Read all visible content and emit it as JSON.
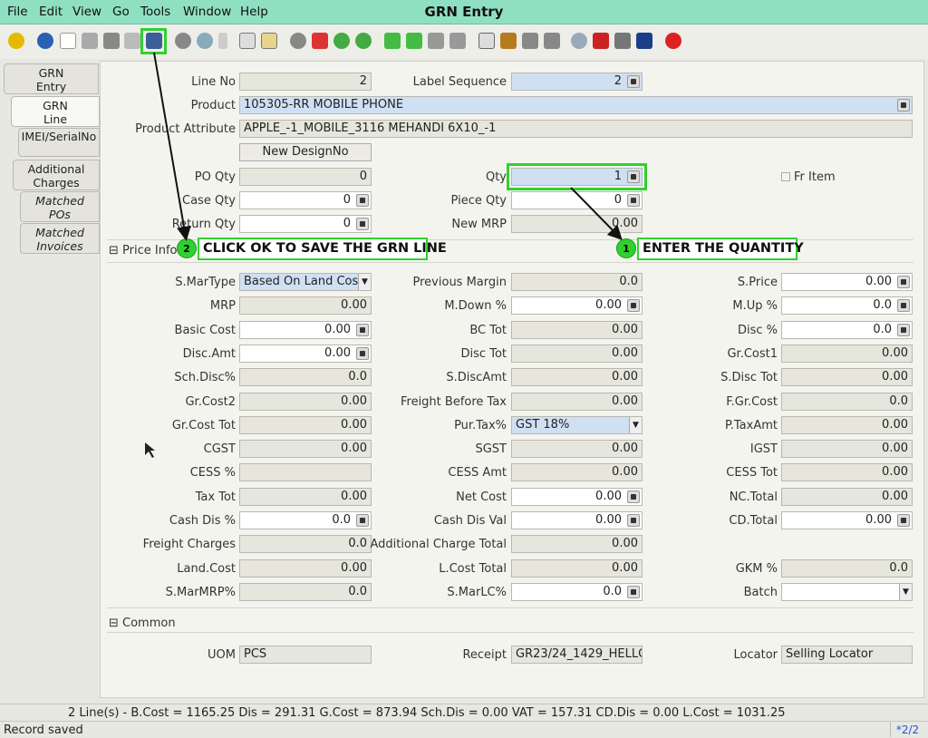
{
  "app_title": "GRN Entry",
  "menu": [
    "File",
    "Edit",
    "View",
    "Go",
    "Tools",
    "Window",
    "Help"
  ],
  "toolbar_icons": [
    "undo-icon",
    "help-icon",
    "new-icon",
    "copy-icon",
    "delete-icon",
    "delete-selection-icon",
    "save-icon",
    "refresh-icon",
    "find-icon",
    "attachment-icon",
    "chat-icon",
    "history-icon",
    "home-icon",
    "parent-icon",
    "previous-icon",
    "next-icon",
    "first-icon",
    "prev-record-icon",
    "next-record-icon",
    "last-icon",
    "report-icon",
    "archive-icon",
    "print-icon",
    "print-preview-icon",
    "zoom-across-icon",
    "workflow-icon",
    "process-icon",
    "product-info-icon",
    "exit-icon"
  ],
  "left_tabs": [
    {
      "label": "GRN\nEntry",
      "active": false,
      "italic": false
    },
    {
      "label": "GRN\nLine",
      "active": true,
      "italic": false
    },
    {
      "label": "IMEI/SerialNo",
      "active": false,
      "italic": false
    },
    {
      "label": "Additional\nCharges",
      "active": false,
      "italic": false
    },
    {
      "label": "Matched\nPOs",
      "active": false,
      "italic": true
    },
    {
      "label": "Matched\nInvoices",
      "active": false,
      "italic": true
    }
  ],
  "fields": {
    "line_no": {
      "label": "Line No",
      "value": "2"
    },
    "label_sequence": {
      "label": "Label Sequence",
      "value": "2"
    },
    "product": {
      "label": "Product",
      "value": "105305-RR MOBILE PHONE"
    },
    "product_attribute": {
      "label": "Product Attribute",
      "value": "APPLE_-1_MOBILE_3116 MEHANDI 6X10_-1"
    },
    "new_design_no": {
      "label": "New DesignNo"
    },
    "po_qty": {
      "label": "PO Qty",
      "value": "0"
    },
    "qty": {
      "label": "Qty",
      "value": "1"
    },
    "fr_item": {
      "label": "Fr Item"
    },
    "case_qty": {
      "label": "Case Qty",
      "value": "0"
    },
    "piece_qty": {
      "label": "Piece Qty",
      "value": "0"
    },
    "return_qty": {
      "label": "Return Qty",
      "value": "0"
    },
    "new_mrp": {
      "label": "New MRP",
      "value": "0.00"
    }
  },
  "price_info": {
    "section_label": "Price Info",
    "s_martype": {
      "label": "S.MarType",
      "value": "Based On Land Cost"
    },
    "previous_margin": {
      "label": "Previous Margin",
      "value": "0.0"
    },
    "s_price": {
      "label": "S.Price",
      "value": "0.00"
    },
    "mrp": {
      "label": "MRP",
      "value": "0.00"
    },
    "m_down": {
      "label": "M.Down %",
      "value": "0.00"
    },
    "m_up": {
      "label": "M.Up %",
      "value": "0.0"
    },
    "basic_cost": {
      "label": "Basic Cost",
      "value": "0.00"
    },
    "bc_tot": {
      "label": "BC Tot",
      "value": "0.00"
    },
    "disc_pct": {
      "label": "Disc %",
      "value": "0.0"
    },
    "disc_amt": {
      "label": "Disc.Amt",
      "value": "0.00"
    },
    "disc_tot": {
      "label": "Disc Tot",
      "value": "0.00"
    },
    "gr_cost1": {
      "label": "Gr.Cost1",
      "value": "0.00"
    },
    "sch_disc_pct": {
      "label": "Sch.Disc%",
      "value": "0.0"
    },
    "s_discamt": {
      "label": "S.DiscAmt",
      "value": "0.00"
    },
    "s_disc_tot": {
      "label": "S.Disc Tot",
      "value": "0.00"
    },
    "gr_cost2": {
      "label": "Gr.Cost2",
      "value": "0.00"
    },
    "freight_before_tax": {
      "label": "Freight Before Tax",
      "value": "0.00"
    },
    "f_gr_cost": {
      "label": "F.Gr.Cost",
      "value": "0.0"
    },
    "gr_cost_tot": {
      "label": "Gr.Cost Tot",
      "value": "0.00"
    },
    "pur_tax": {
      "label": "Pur.Tax%",
      "value": "GST 18%"
    },
    "p_taxamt": {
      "label": "P.TaxAmt",
      "value": "0.00"
    },
    "cgst": {
      "label": "CGST",
      "value": "0.00"
    },
    "sgst": {
      "label": "SGST",
      "value": "0.00"
    },
    "igst": {
      "label": "IGST",
      "value": "0.00"
    },
    "cess_pct": {
      "label": "CESS %",
      "value": ""
    },
    "cess_amt": {
      "label": "CESS Amt",
      "value": "0.00"
    },
    "cess_tot": {
      "label": "CESS Tot",
      "value": "0.00"
    },
    "tax_tot": {
      "label": "Tax Tot",
      "value": "0.00"
    },
    "net_cost": {
      "label": "Net Cost",
      "value": "0.00"
    },
    "nc_total": {
      "label": "NC.Total",
      "value": "0.00"
    },
    "cash_dis_pct": {
      "label": "Cash Dis %",
      "value": "0.0"
    },
    "cash_dis_val": {
      "label": "Cash Dis Val",
      "value": "0.00"
    },
    "cd_total": {
      "label": "CD.Total",
      "value": "0.00"
    },
    "freight_charges": {
      "label": "Freight Charges",
      "value": "0.0"
    },
    "additional_charge_total": {
      "label": "Additional Charge Total",
      "value": "0.00"
    },
    "land_cost": {
      "label": "Land.Cost",
      "value": "0.00"
    },
    "l_cost_total": {
      "label": "L.Cost Total",
      "value": "0.00"
    },
    "gkm_pct": {
      "label": "GKM %",
      "value": "0.0"
    },
    "s_marmrp": {
      "label": "S.MarMRP%",
      "value": "0.0"
    },
    "s_marlc": {
      "label": "S.MarLC%",
      "value": "0.0"
    },
    "batch": {
      "label": "Batch",
      "value": ""
    }
  },
  "common": {
    "section_label": "Common",
    "uom": {
      "label": "UOM",
      "value": "PCS"
    },
    "receipt": {
      "label": "Receipt",
      "value": "GR23/24_1429_HELLC"
    },
    "locator": {
      "label": "Locator",
      "value": "Selling Locator"
    }
  },
  "callouts": {
    "save": {
      "badge": "2",
      "text": "CLICK OK TO SAVE THE GRN LINE"
    },
    "qty": {
      "badge": "1",
      "text": "ENTER THE QUANTITY"
    }
  },
  "status": {
    "totals": "2 Line(s) -   B.Cost = 1165.25    Dis = 291.31    G.Cost = 873.94    Sch.Dis = 0.00    VAT = 157.31    CD.Dis = 0.00    L.Cost = 1031.25",
    "message": "Record saved",
    "page": "*2/2"
  },
  "colors": {
    "menubar": "#8fe0c2",
    "highlight": "#2fd12f",
    "blue_field": "#cfe0f3"
  }
}
